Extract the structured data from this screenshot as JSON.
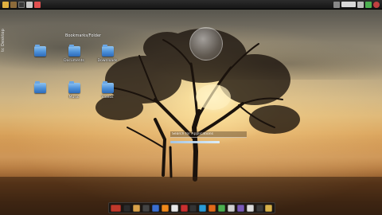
{
  "desktop": {
    "title": "Bookmarks/Folder",
    "side_label": "tc Desktop",
    "icons": [
      {
        "label": ""
      },
      {
        "label": "Documents"
      },
      {
        "label": "Downloads"
      },
      {
        "label": ""
      },
      {
        "label": "Music"
      },
      {
        "label": "Videos"
      }
    ]
  },
  "search": {
    "placeholder": "Search for Applications"
  },
  "top_panel": {
    "left_icons": [
      "menu-icon",
      "files-icon",
      "terminal-icon",
      "browser-icon",
      "user-icon"
    ],
    "right_icons": [
      "network-icon",
      "display-icon",
      "volume-icon",
      "battery-icon",
      "power-icon"
    ]
  },
  "dock": {
    "items": [
      {
        "name": "media-player-icon",
        "color": "#c0392b"
      },
      {
        "name": "terminal-icon",
        "color": "#2b2b2b"
      },
      {
        "name": "file-manager-icon",
        "color": "#d9a24a"
      },
      {
        "name": "back-icon",
        "color": "#444444"
      },
      {
        "name": "settings-icon",
        "color": "#3b6fd0"
      },
      {
        "name": "vlc-icon",
        "color": "#f08a1c"
      },
      {
        "name": "document-icon",
        "color": "#e8e8e8"
      },
      {
        "name": "pdf-icon",
        "color": "#c93030"
      },
      {
        "name": "video-icon",
        "color": "#333333"
      },
      {
        "name": "chat-icon",
        "color": "#2a9bd6"
      },
      {
        "name": "browser-icon",
        "color": "#e06a1a"
      },
      {
        "name": "chrome-icon",
        "color": "#4caf50"
      },
      {
        "name": "mail-icon",
        "color": "#cfcfcf"
      },
      {
        "name": "image-viewer-icon",
        "color": "#7a5ab8"
      },
      {
        "name": "calculator-icon",
        "color": "#dddddd"
      },
      {
        "name": "apps-grid-icon",
        "color": "#3a3a3a"
      },
      {
        "name": "archive-icon",
        "color": "#d8b24a"
      }
    ]
  }
}
